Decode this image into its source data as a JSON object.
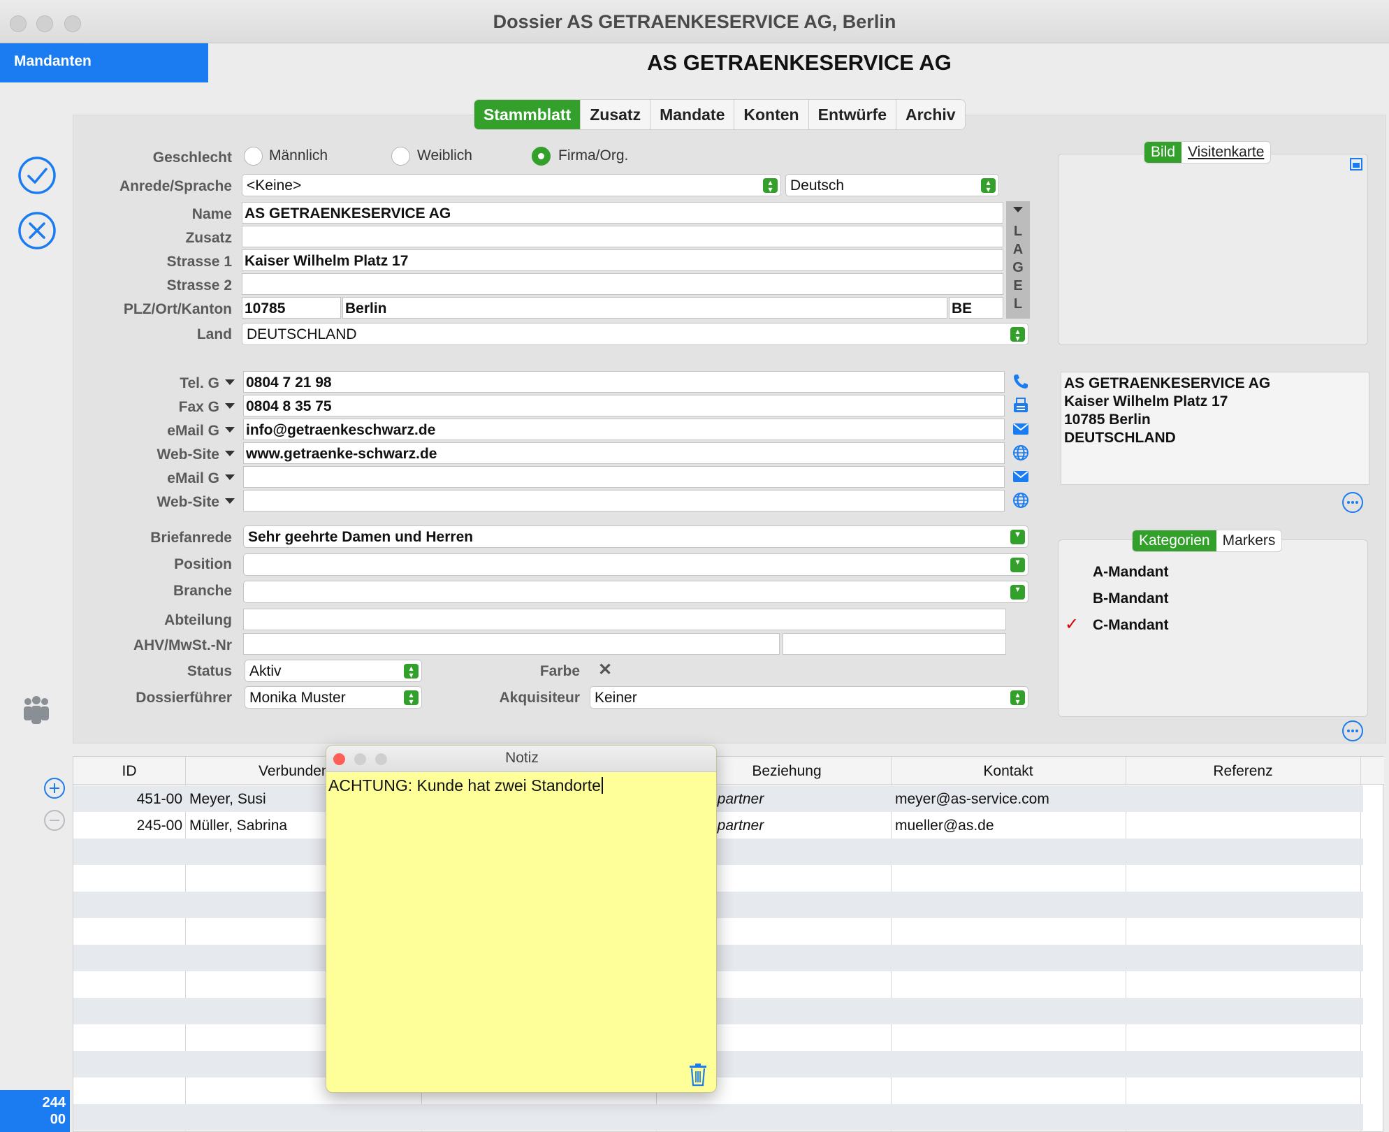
{
  "window": {
    "title": "Dossier AS GETRAENKESERVICE AG, Berlin"
  },
  "sidebar": {
    "mandanten_label": "Mandanten",
    "count_line1": "244",
    "count_line2": "00"
  },
  "header": {
    "client_name": "AS GETRAENKESERVICE AG"
  },
  "tabs": [
    "Stammblatt",
    "Zusatz",
    "Mandate",
    "Konten",
    "Entwürfe",
    "Archiv"
  ],
  "form": {
    "geschlecht_label": "Geschlecht",
    "gender_options": [
      "Männlich",
      "Weiblich",
      "Firma/Org."
    ],
    "gender_selected": "Firma/Org.",
    "anrede_label": "Anrede/Sprache",
    "anrede_value": "<Keine>",
    "sprache_value": "Deutsch",
    "name_label": "Name",
    "name_value": "AS GETRAENKESERVICE AG",
    "zusatz_label": "Zusatz",
    "zusatz_value": "",
    "strasse1_label": "Strasse 1",
    "strasse1_value": "Kaiser Wilhelm Platz 17",
    "strasse2_label": "Strasse 2",
    "strasse2_value": "",
    "plz_label": "PLZ/Ort/Kanton",
    "plz_value": "10785",
    "ort_value": "Berlin",
    "kanton_value": "BE",
    "land_label": "Land",
    "land_value": "DEUTSCHLAND",
    "legal_label": "LEGAL",
    "contacts": [
      {
        "label": "Tel. G",
        "value": "0804 7 21 98",
        "icon": "phone-icon"
      },
      {
        "label": "Fax G",
        "value": "0804 8 35 75",
        "icon": "fax-icon"
      },
      {
        "label": "eMail G",
        "value": "info@getraenkeschwarz.de",
        "icon": "mail-icon"
      },
      {
        "label": "Web-Site",
        "value": "www.getraenke-schwarz.de",
        "icon": "globe-icon"
      },
      {
        "label": "eMail G",
        "value": "",
        "icon": "mail-icon"
      },
      {
        "label": "Web-Site",
        "value": "",
        "icon": "globe-icon"
      }
    ],
    "briefanrede_label": "Briefanrede",
    "briefanrede_value": "Sehr geehrte Damen und Herren",
    "position_label": "Position",
    "position_value": "",
    "branche_label": "Branche",
    "branche_value": "",
    "abteilung_label": "Abteilung",
    "abteilung_value": "",
    "ahv_label": "AHV/MwSt.-Nr",
    "ahv_value": "",
    "ahv_value2": "",
    "status_label": "Status",
    "status_value": "Aktiv",
    "farbe_label": "Farbe",
    "farbe_value": "✕",
    "dossierfuehrer_label": "Dossierführer",
    "dossierfuehrer_value": "Monika Muster",
    "akquisiteur_label": "Akquisiteur",
    "akquisiteur_value": "Keiner"
  },
  "right_panel": {
    "image_tabs": [
      "Bild",
      "Visitenkarte"
    ],
    "address_lines": [
      "AS GETRAENKESERVICE AG",
      "Kaiser Wilhelm Platz 17",
      "10785 Berlin",
      "DEUTSCHLAND"
    ],
    "category_tabs": [
      "Kategorien",
      "Markers"
    ],
    "categories": [
      {
        "name": "A-Mandant",
        "checked": false
      },
      {
        "name": "B-Mandant",
        "checked": false
      },
      {
        "name": "C-Mandant",
        "checked": true
      }
    ],
    "check_mark": "✓"
  },
  "table": {
    "columns": [
      "ID",
      "Verbundene A",
      "",
      "Beziehung",
      "Kontakt",
      "Referenz"
    ],
    "rows": [
      {
        "id": "451-00",
        "name": "Meyer, Susi",
        "beziehung": "hpartner",
        "kontakt": "meyer@as-service.com",
        "referenz": ""
      },
      {
        "id": "245-00",
        "name": "Müller, Sabrina",
        "beziehung": "hpartner",
        "kontakt": "mueller@as.de",
        "referenz": ""
      }
    ]
  },
  "note": {
    "title": "Notiz",
    "text": "ACHTUNG: Kunde hat zwei Standorte"
  },
  "colors": {
    "accent_green": "#34a02c",
    "accent_blue": "#1a7cf0",
    "note_yellow": "#ffff99",
    "check_red": "#dd0000"
  }
}
